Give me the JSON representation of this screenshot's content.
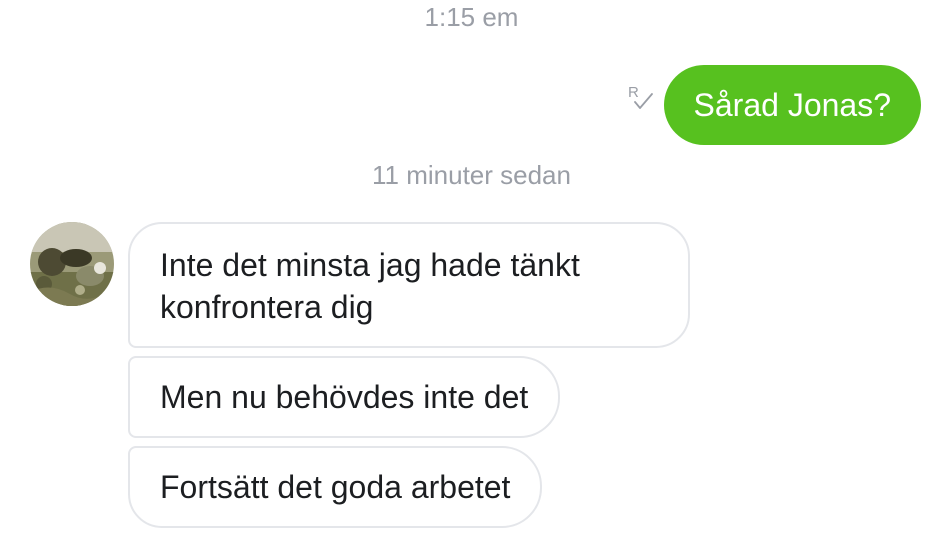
{
  "conversation": {
    "timestamps": [
      "1:15 em",
      "11 minuter sedan"
    ],
    "sent_message": {
      "text": "Sårad Jonas?",
      "bubble_color": "#57c11f",
      "read_receipt_icon": "read-receipt-icon"
    },
    "received_messages": [
      {
        "lines": [
          "Inte det minsta jag hade tänkt",
          "konfrontera dig"
        ]
      },
      {
        "text": "Men nu behövdes inte det"
      },
      {
        "text": "Fortsätt det goda arbetet"
      }
    ],
    "contact_avatar_icon": "avatar",
    "colors": {
      "timestamp": "#9a9ea6",
      "received_border": "#e4e6ea",
      "received_text": "#1c1e21"
    }
  }
}
